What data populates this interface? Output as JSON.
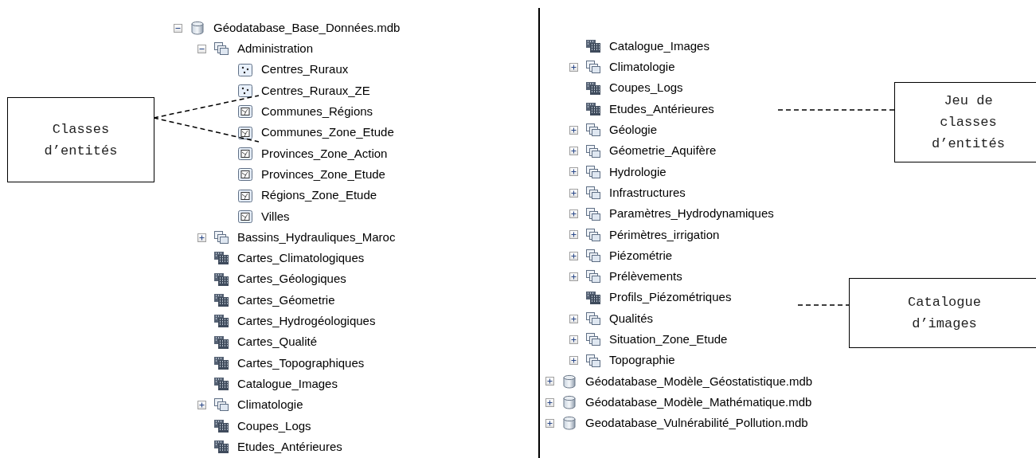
{
  "left_tree": {
    "items": [
      {
        "label": "Géodatabase_Base_Données.mdb",
        "kind": "database",
        "expanded": true,
        "children": [
          {
            "label": "Administration",
            "kind": "feature_dataset",
            "expanded": true,
            "children": [
              {
                "label": "Centres_Ruraux",
                "kind": "point_class"
              },
              {
                "label": "Centres_Ruraux_ZE",
                "kind": "point_class"
              },
              {
                "label": "Communes_Régions",
                "kind": "polygon_class"
              },
              {
                "label": "Communes_Zone_Etude",
                "kind": "polygon_class"
              },
              {
                "label": "Provinces_Zone_Action",
                "kind": "polygon_class"
              },
              {
                "label": "Provinces_Zone_Etude",
                "kind": "polygon_class"
              },
              {
                "label": "Régions_Zone_Etude",
                "kind": "polygon_class"
              },
              {
                "label": "Villes",
                "kind": "polygon_class"
              }
            ]
          },
          {
            "label": "Bassins_Hydrauliques_Maroc",
            "kind": "feature_dataset",
            "expanded": false
          },
          {
            "label": "Cartes_Climatologiques",
            "kind": "raster_catalog"
          },
          {
            "label": "Cartes_Géologiques",
            "kind": "raster_catalog"
          },
          {
            "label": "Cartes_Géometrie",
            "kind": "raster_catalog"
          },
          {
            "label": "Cartes_Hydrogéologiques",
            "kind": "raster_catalog"
          },
          {
            "label": "Cartes_Qualité",
            "kind": "raster_catalog"
          },
          {
            "label": "Cartes_Topographiques",
            "kind": "raster_catalog"
          },
          {
            "label": "Catalogue_Images",
            "kind": "raster_catalog"
          },
          {
            "label": "Climatologie",
            "kind": "feature_dataset",
            "expanded": false
          },
          {
            "label": "Coupes_Logs",
            "kind": "raster_catalog"
          },
          {
            "label": "Etudes_Antérieures",
            "kind": "raster_catalog"
          }
        ]
      }
    ]
  },
  "right_tree": {
    "continued_items": [
      {
        "label": "Catalogue_Images",
        "kind": "raster_catalog"
      },
      {
        "label": "Climatologie",
        "kind": "feature_dataset",
        "expanded": false
      },
      {
        "label": "Coupes_Logs",
        "kind": "raster_catalog"
      },
      {
        "label": "Etudes_Antérieures",
        "kind": "raster_catalog"
      },
      {
        "label": "Géologie",
        "kind": "feature_dataset",
        "expanded": false
      },
      {
        "label": "Géometrie_Aquifère",
        "kind": "feature_dataset",
        "expanded": false
      },
      {
        "label": "Hydrologie",
        "kind": "feature_dataset",
        "expanded": false
      },
      {
        "label": "Infrastructures",
        "kind": "feature_dataset",
        "expanded": false
      },
      {
        "label": "Paramètres_Hydrodynamiques",
        "kind": "feature_dataset",
        "expanded": false
      },
      {
        "label": "Périmètres_irrigation",
        "kind": "feature_dataset",
        "expanded": false
      },
      {
        "label": "Piézométrie",
        "kind": "feature_dataset",
        "expanded": false
      },
      {
        "label": "Prélèvements",
        "kind": "feature_dataset",
        "expanded": false
      },
      {
        "label": "Profils_Piézométriques",
        "kind": "raster_catalog"
      },
      {
        "label": "Qualités",
        "kind": "feature_dataset",
        "expanded": false
      },
      {
        "label": "Situation_Zone_Etude",
        "kind": "feature_dataset",
        "expanded": false
      },
      {
        "label": "Topographie",
        "kind": "feature_dataset",
        "expanded": false
      }
    ],
    "items": [
      {
        "label": "Géodatabase_Modèle_Géostatistique.mdb",
        "kind": "database",
        "expanded": false
      },
      {
        "label": "Géodatabase_Modèle_Mathématique.mdb",
        "kind": "database",
        "expanded": false
      },
      {
        "label": "Geodatabase_Vulnérabilité_Pollution.mdb",
        "kind": "database",
        "expanded": false
      }
    ]
  },
  "callouts": [
    {
      "text": "Classes d’entités"
    },
    {
      "text": "Jeu de classes d’entités"
    },
    {
      "text": "Catalogue d’images"
    }
  ]
}
